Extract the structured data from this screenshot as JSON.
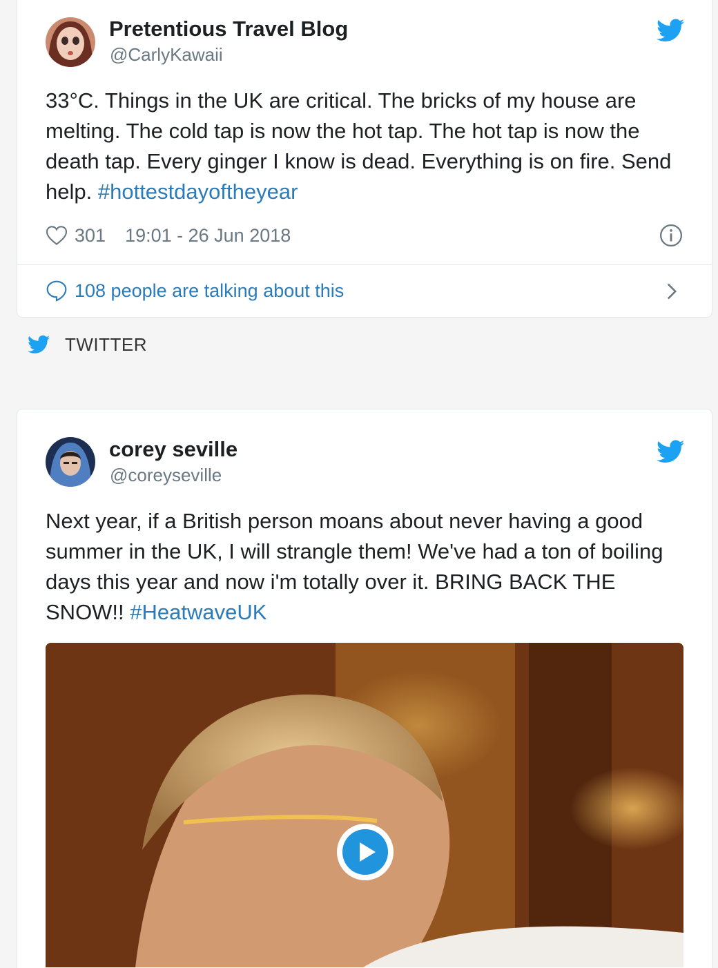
{
  "tweets": [
    {
      "author_name": "Pretentious Travel Blog",
      "handle": "@CarlyKawaii",
      "text": "33°C. Things in the UK are critical. The bricks of my house are melting. The cold tap is now the hot tap. The hot tap is now the death tap. Every ginger I know is dead. Everything is on fire. Send help.",
      "hashtag": "#hottestdayoftheyear",
      "likes": "301",
      "timestamp": "19:01 - 26 Jun 2018",
      "talking": "108 people are talking about this"
    },
    {
      "author_name": "corey seville",
      "handle": "@coreyseville",
      "text": "Next year, if a British person moans about never having a good summer in the UK, I will strangle them! We've had a ton of boiling days this year and now i'm totally over it. BRING BACK THE SNOW!!",
      "hashtag": "#HeatwaveUK"
    }
  ],
  "source": {
    "label": "TWITTER"
  },
  "colors": {
    "twitter_blue": "#1da1f2",
    "link_blue": "#2b7bb9",
    "muted": "#697882",
    "text": "#1c2022",
    "border": "#e1e8ed"
  },
  "icons": {
    "bird": "twitter-bird-icon",
    "heart": "heart-icon",
    "info": "info-icon",
    "comment": "comment-bubble-icon",
    "chevron": "chevron-right-icon",
    "play": "play-icon"
  }
}
